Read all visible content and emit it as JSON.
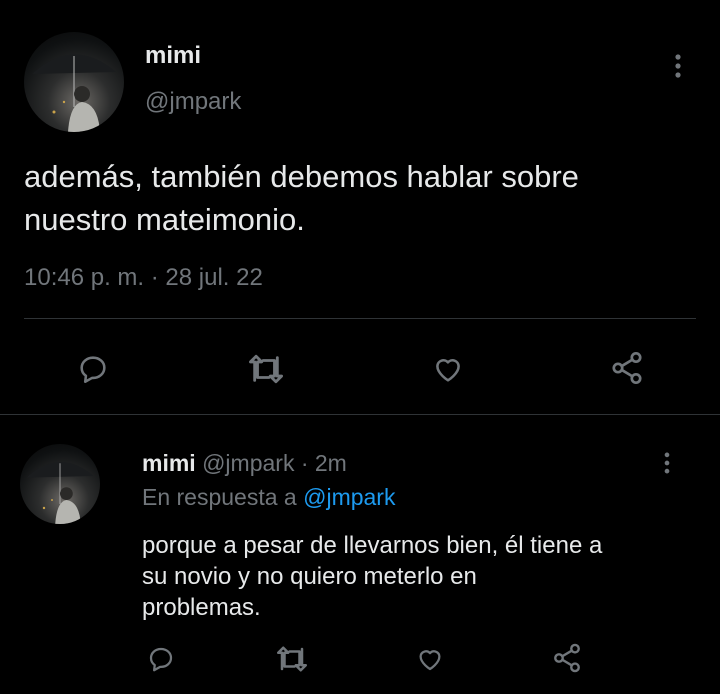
{
  "main_tweet": {
    "author_name": "mimi",
    "handle": "@jmpark",
    "text_line1": "además, también debemos hablar sobre",
    "text_line2": "nuestro mateimonio.",
    "timestamp": "10:46 p. m. · 28 jul. 22",
    "icons": [
      "more-vertical-icon",
      "reply-icon",
      "retweet-icon",
      "like-icon",
      "share-icon"
    ]
  },
  "reply": {
    "author_name": "mimi",
    "handle_time": "@jmpark · 2m",
    "replying_prefix": "En respuesta a ",
    "replying_handle": "@jmpark",
    "text_line1": "porque a pesar de llevarnos bien, él tiene a",
    "text_line2": "su novio y no quiero meterlo en",
    "text_line3": "problemas.",
    "icons": [
      "more-vertical-icon",
      "reply-icon",
      "retweet-icon",
      "like-icon",
      "share-icon"
    ]
  },
  "colors": {
    "background": "#000000",
    "text": "#e7e9ea",
    "muted": "#71767b",
    "link": "#1d9bf0",
    "divider": "#2f3336"
  }
}
